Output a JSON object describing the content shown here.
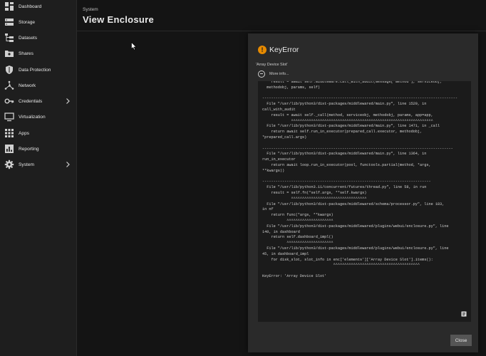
{
  "sidebar": {
    "items": [
      {
        "label": "Dashboard",
        "icon": "dashboard-icon"
      },
      {
        "label": "Storage",
        "icon": "storage-icon"
      },
      {
        "label": "Datasets",
        "icon": "datasets-icon"
      },
      {
        "label": "Shares",
        "icon": "shares-icon"
      },
      {
        "label": "Data Protection",
        "icon": "shield-icon"
      },
      {
        "label": "Network",
        "icon": "network-icon"
      },
      {
        "label": "Credentials",
        "icon": "key-icon"
      },
      {
        "label": "Virtualization",
        "icon": "monitor-icon"
      },
      {
        "label": "Apps",
        "icon": "apps-grid-icon"
      },
      {
        "label": "Reporting",
        "icon": "reporting-icon"
      },
      {
        "label": "System",
        "icon": "gear-icon"
      }
    ]
  },
  "header": {
    "breadcrumb": "System",
    "title": "View Enclosure"
  },
  "dialog": {
    "title": "KeyError",
    "subtitle": "'Array Device Slot'",
    "more_info": "More info...",
    "close_label": "Close",
    "icon_color": "#e68a00",
    "traceback": "    result = await self.middleware.call_with_audit(message['method'], serviceobj,\n  methodobj, params, self)\n\n----------------------------------------------------------------------------------------\n  File \"/usr/lib/python3/dist-packages/middlewared/main.py\", line 1529, in\ncall_with_audit\n    result = await self._call(method, serviceobj, methodobj, params, app=app,\n             ^^^^^^^^^^^^^^^^^^^^^^^^^^^^^^^^^^^^^^^^^^^^^^^^^^^^^^^^^^^^^^^^\n  File \"/usr/lib/python3/dist-packages/middlewared/main.py\", line 1471, in _call\n    return await self.run_in_executor(prepared_call.executor, methodobj,\n*prepared_call.args)\n\n--------------------------------------------------------------------------------------\n  File \"/usr/lib/python3/dist-packages/middlewared/main.py\", line 1364, in\nrun_in_executor\n    return await loop.run_in_executor(pool, functools.partial(method, *args,\n**kwargs))\n\n----------------------------------------------------------------------------\n  File \"/usr/lib/python3.11/concurrent/futures/thread.py\", line 58, in run\n    result = self.fn(*self.args, **self.kwargs)\n             ^^^^^^^^^^^^^^^^^^^^^^^^^^^^^^^^^^\n  File \"/usr/lib/python3/dist-packages/middlewared/schema/processor.py\", line 183,\nin nf\n    return func(*args, **kwargs)\n           ^^^^^^^^^^^^^^^^^^^^^\n  File \"/usr/lib/python3/dist-packages/middlewared/plugins/webui/enclosure.py\", line\n140, in dashboard\n    return self.dashboard_impl()\n           ^^^^^^^^^^^^^^^^^^^^^\n  File \"/usr/lib/python3/dist-packages/middlewared/plugins/webui/enclosure.py\", line\n45, in dashboard_impl\n    for disk_slot, slot_info in enc['elements']['Array Device Slot'].items():\n                                ^^^^^^^^^^^^^^^^^^^^^^^^^^^^^^^^^^^^^^^\n\nKeyError: 'Array Device Slot'"
  }
}
